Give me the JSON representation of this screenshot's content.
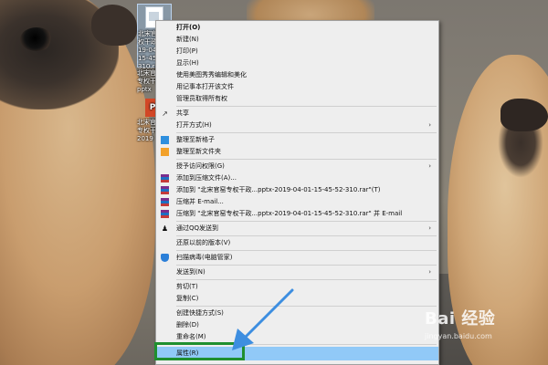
{
  "desktop": {
    "selected_icon_text": "北宋官窑专权干政...019-04-01-15-45-52-310.rar",
    "ppt_icon_text": "北宋官窑专权干政.pptx",
    "third_icon_text": "北宋官窑专权干政-2019"
  },
  "context_menu": {
    "items": [
      {
        "label": "打开(O)",
        "bold": true
      },
      {
        "label": "新建(N)"
      },
      {
        "label": "打印(P)"
      },
      {
        "label": "显示(H)"
      },
      {
        "label": "使用美图秀秀编辑和美化"
      },
      {
        "label": "用记事本打开该文件"
      },
      {
        "label": "管理员取得所有权"
      },
      {
        "label": "共享",
        "icon": "share-icon"
      },
      {
        "label": "打开方式(H)",
        "submenu": true
      },
      {
        "label": "整理至新格子",
        "icon": "fences-blue-icon"
      },
      {
        "label": "整理至新文件夹",
        "icon": "fences-orange-icon"
      },
      {
        "label": "授予访问权限(G)",
        "submenu": true
      },
      {
        "label": "添加到压缩文件(A)...",
        "icon": "winrar-icon"
      },
      {
        "label": "添加到 \"北宋官窑专权干政...pptx-2019-04-01-15-45-52-310.rar\"(T)",
        "icon": "winrar-icon"
      },
      {
        "label": "压缩并 E-mail...",
        "icon": "winrar-icon"
      },
      {
        "label": "压缩到 \"北宋官窑专权干政...pptx-2019-04-01-15-45-52-310.rar\" 并 E-mail",
        "icon": "winrar-icon"
      },
      {
        "label": "通过QQ发送到",
        "icon": "qq-icon",
        "submenu": true
      },
      {
        "label": "还原以前的版本(V)"
      },
      {
        "label": "扫描病毒(电脑管家)",
        "icon": "shield-icon"
      },
      {
        "label": "发送到(N)",
        "submenu": true
      },
      {
        "label": "剪切(T)"
      },
      {
        "label": "复制(C)"
      },
      {
        "label": "创建快捷方式(S)"
      },
      {
        "label": "删除(D)"
      },
      {
        "label": "重命名(M)"
      },
      {
        "label": "属性(R)",
        "highlighted": true
      }
    ]
  },
  "watermark": {
    "logo": "Bai 经验",
    "url": "jingyan.baidu.com"
  },
  "colors": {
    "highlight": "#91c9f7",
    "annotation_box": "#1f8f2f",
    "annotation_arrow": "#3d8ee0"
  }
}
